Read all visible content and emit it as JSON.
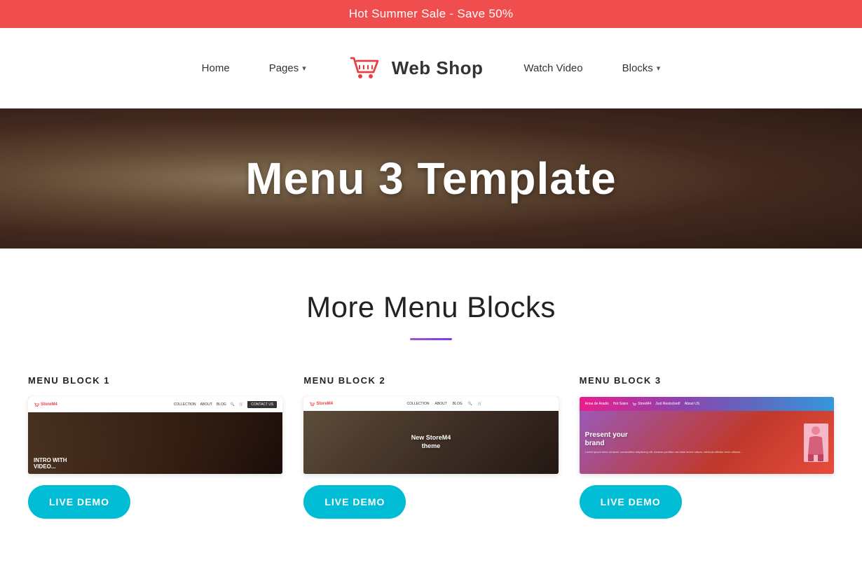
{
  "banner": {
    "text": "Hot Summer Sale - Save 50%"
  },
  "nav": {
    "home_label": "Home",
    "pages_label": "Pages",
    "logo_text": "Web Shop",
    "watch_video_label": "Watch Video",
    "blocks_label": "Blocks"
  },
  "hero": {
    "title": "Menu 3 Template"
  },
  "section": {
    "title": "More Menu Blocks",
    "divider_color": "#9b59b6"
  },
  "blocks": [
    {
      "label": "MENU BLOCK 1",
      "preview_type": "block1",
      "nav_logo": "StoreM4",
      "nav_links": [
        "COLLECTION",
        "ABOUT",
        "BLOG"
      ],
      "hero_text": "INTRO WITH\nVIDEO...",
      "button_label": "LIVE DEMO"
    },
    {
      "label": "MENU BLOCK 2",
      "preview_type": "block2",
      "nav_logo": "StoreM4",
      "nav_links": [
        "COLLECTION",
        "ABOUT",
        "BLOG"
      ],
      "hero_text": "New StoreM4\ntheme",
      "button_label": "LIVE DEMO"
    },
    {
      "label": "MENU BLOCK 3",
      "preview_type": "block3",
      "nav_links": [
        "Anna de Aradis",
        "Hot Sales",
        "StoreM4",
        "Just Restocked!",
        "About US"
      ],
      "hero_title": "Present your\nbrand",
      "hero_body": "Lorem ipsum dolor sit amet, consectetur adipiscing elit. Aenean porttitor nisi vitae lorem rutrum, vehicula efficitur enim ultrices...",
      "button_label": "LIVE DEMO"
    }
  ],
  "colors": {
    "banner_bg": "#f04e4e",
    "accent_cyan": "#00bcd4",
    "accent_purple": "#9b59b6",
    "logo_red": "#e84040"
  }
}
